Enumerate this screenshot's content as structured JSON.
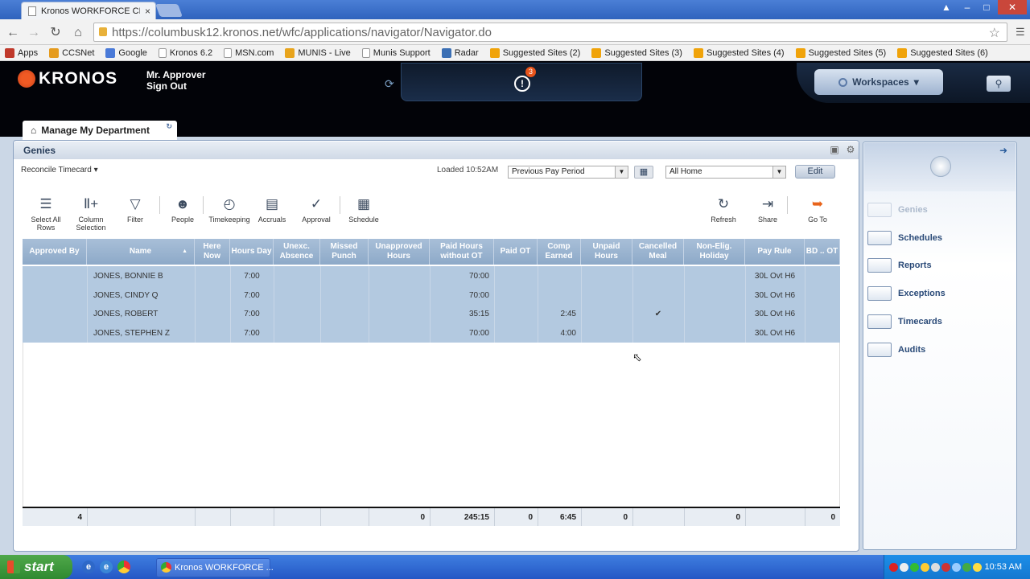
{
  "browser": {
    "tab_title": "Kronos WORKFORCE CENTR",
    "tab_close": "×",
    "url": "https://columbusk12.kronos.net/wfc/applications/navigator/Navigator.do",
    "win_buttons": [
      "▲",
      "–",
      "□",
      "✕"
    ]
  },
  "bookmarks": [
    {
      "label": "Apps",
      "icon": "apps-icon",
      "color": "#c0392b"
    },
    {
      "label": "CCSNet",
      "icon": "ccsnet-icon",
      "color": "#e59b1e"
    },
    {
      "label": "Google",
      "icon": "google-icon",
      "color": "#4a7ad8"
    },
    {
      "label": "Kronos 6.2",
      "icon": "page-icon",
      "color": "#ffffff"
    },
    {
      "label": "MSN.com",
      "icon": "page-icon",
      "color": "#ffffff"
    },
    {
      "label": "MUNIS - Live",
      "icon": "munis-icon",
      "color": "#e8a41c"
    },
    {
      "label": "Munis Support",
      "icon": "page-icon",
      "color": "#ffffff"
    },
    {
      "label": "Radar",
      "icon": "radar-icon",
      "color": "#3b6fb4"
    },
    {
      "label": "Suggested Sites (2)",
      "icon": "bing-icon",
      "color": "#f0a30a"
    },
    {
      "label": "Suggested Sites (3)",
      "icon": "bing-icon",
      "color": "#f0a30a"
    },
    {
      "label": "Suggested Sites (4)",
      "icon": "bing-icon",
      "color": "#f0a30a"
    },
    {
      "label": "Suggested Sites (5)",
      "icon": "bing-icon",
      "color": "#f0a30a"
    },
    {
      "label": "Suggested Sites (6)",
      "icon": "bing-icon",
      "color": "#f0a30a"
    }
  ],
  "header": {
    "logo": "KRONOS",
    "user_name": "Mr. Approver",
    "sign_out": "Sign Out",
    "alert_count": "3",
    "workspaces": "Workspaces"
  },
  "workspace_tab": "Manage My Department",
  "genies": {
    "title": "Genies",
    "genie_select": "Reconcile Timecard",
    "loaded": "Loaded 10:52AM",
    "period": "Previous Pay Period",
    "location": "All Home",
    "edit": "Edit"
  },
  "toolbar": [
    {
      "id": "select-all-rows",
      "label": "Select All Rows",
      "icon": "☰"
    },
    {
      "id": "column-selection",
      "label": "Column Selection",
      "icon": "Ⅱ+"
    },
    {
      "id": "filter",
      "label": "Filter",
      "icon": "▽"
    },
    {
      "id": "people",
      "label": "People",
      "icon": "☻"
    },
    {
      "id": "timekeeping",
      "label": "Timekeeping",
      "icon": "◴"
    },
    {
      "id": "accruals",
      "label": "Accruals",
      "icon": "▤"
    },
    {
      "id": "approval",
      "label": "Approval",
      "icon": "✓"
    },
    {
      "id": "schedule",
      "label": "Schedule",
      "icon": "▦"
    },
    {
      "id": "refresh",
      "label": "Refresh",
      "icon": "↻"
    },
    {
      "id": "share",
      "label": "Share",
      "icon": "⇥"
    },
    {
      "id": "go-to",
      "label": "Go To",
      "icon": "➥"
    }
  ],
  "table": {
    "columns": [
      "Approved By",
      "Name",
      "Here Now",
      "Hours Day",
      "Unexc. Absence",
      "Missed Punch",
      "Unapproved Hours",
      "Paid Hours without OT",
      "Paid OT",
      "Comp Earned",
      "Unpaid Hours",
      "Cancelled Meal",
      "Non-Elig. Holiday",
      "Pay Rule",
      "BD .. OT"
    ],
    "sort_indicator": "▲",
    "rows": [
      [
        "",
        "JONES, BONNIE B",
        "",
        "7:00",
        "",
        "",
        "",
        "70:00",
        "",
        "",
        "",
        "",
        "",
        "30L Ovt H6",
        ""
      ],
      [
        "",
        "JONES, CINDY Q",
        "",
        "7:00",
        "",
        "",
        "",
        "70:00",
        "",
        "",
        "",
        "",
        "",
        "30L Ovt H6",
        ""
      ],
      [
        "",
        "JONES, ROBERT",
        "",
        "7:00",
        "",
        "",
        "",
        "35:15",
        "",
        "2:45",
        "",
        "✔",
        "",
        "30L Ovt H6",
        ""
      ],
      [
        "",
        "JONES, STEPHEN Z",
        "",
        "7:00",
        "",
        "",
        "",
        "70:00",
        "",
        "4:00",
        "",
        "",
        "",
        "30L Ovt H6",
        ""
      ]
    ],
    "totals": [
      "4",
      "",
      "",
      "",
      "",
      "",
      "0",
      "245:15",
      "0",
      "6:45",
      "0",
      "",
      "0",
      "",
      "0"
    ]
  },
  "right_pane": {
    "items": [
      "Genies",
      "Schedules",
      "Reports",
      "Exceptions",
      "Timecards",
      "Audits"
    ]
  },
  "taskbar": {
    "start": "start",
    "task": "Kronos WORKFORCE ...",
    "clock": "10:53 AM"
  }
}
